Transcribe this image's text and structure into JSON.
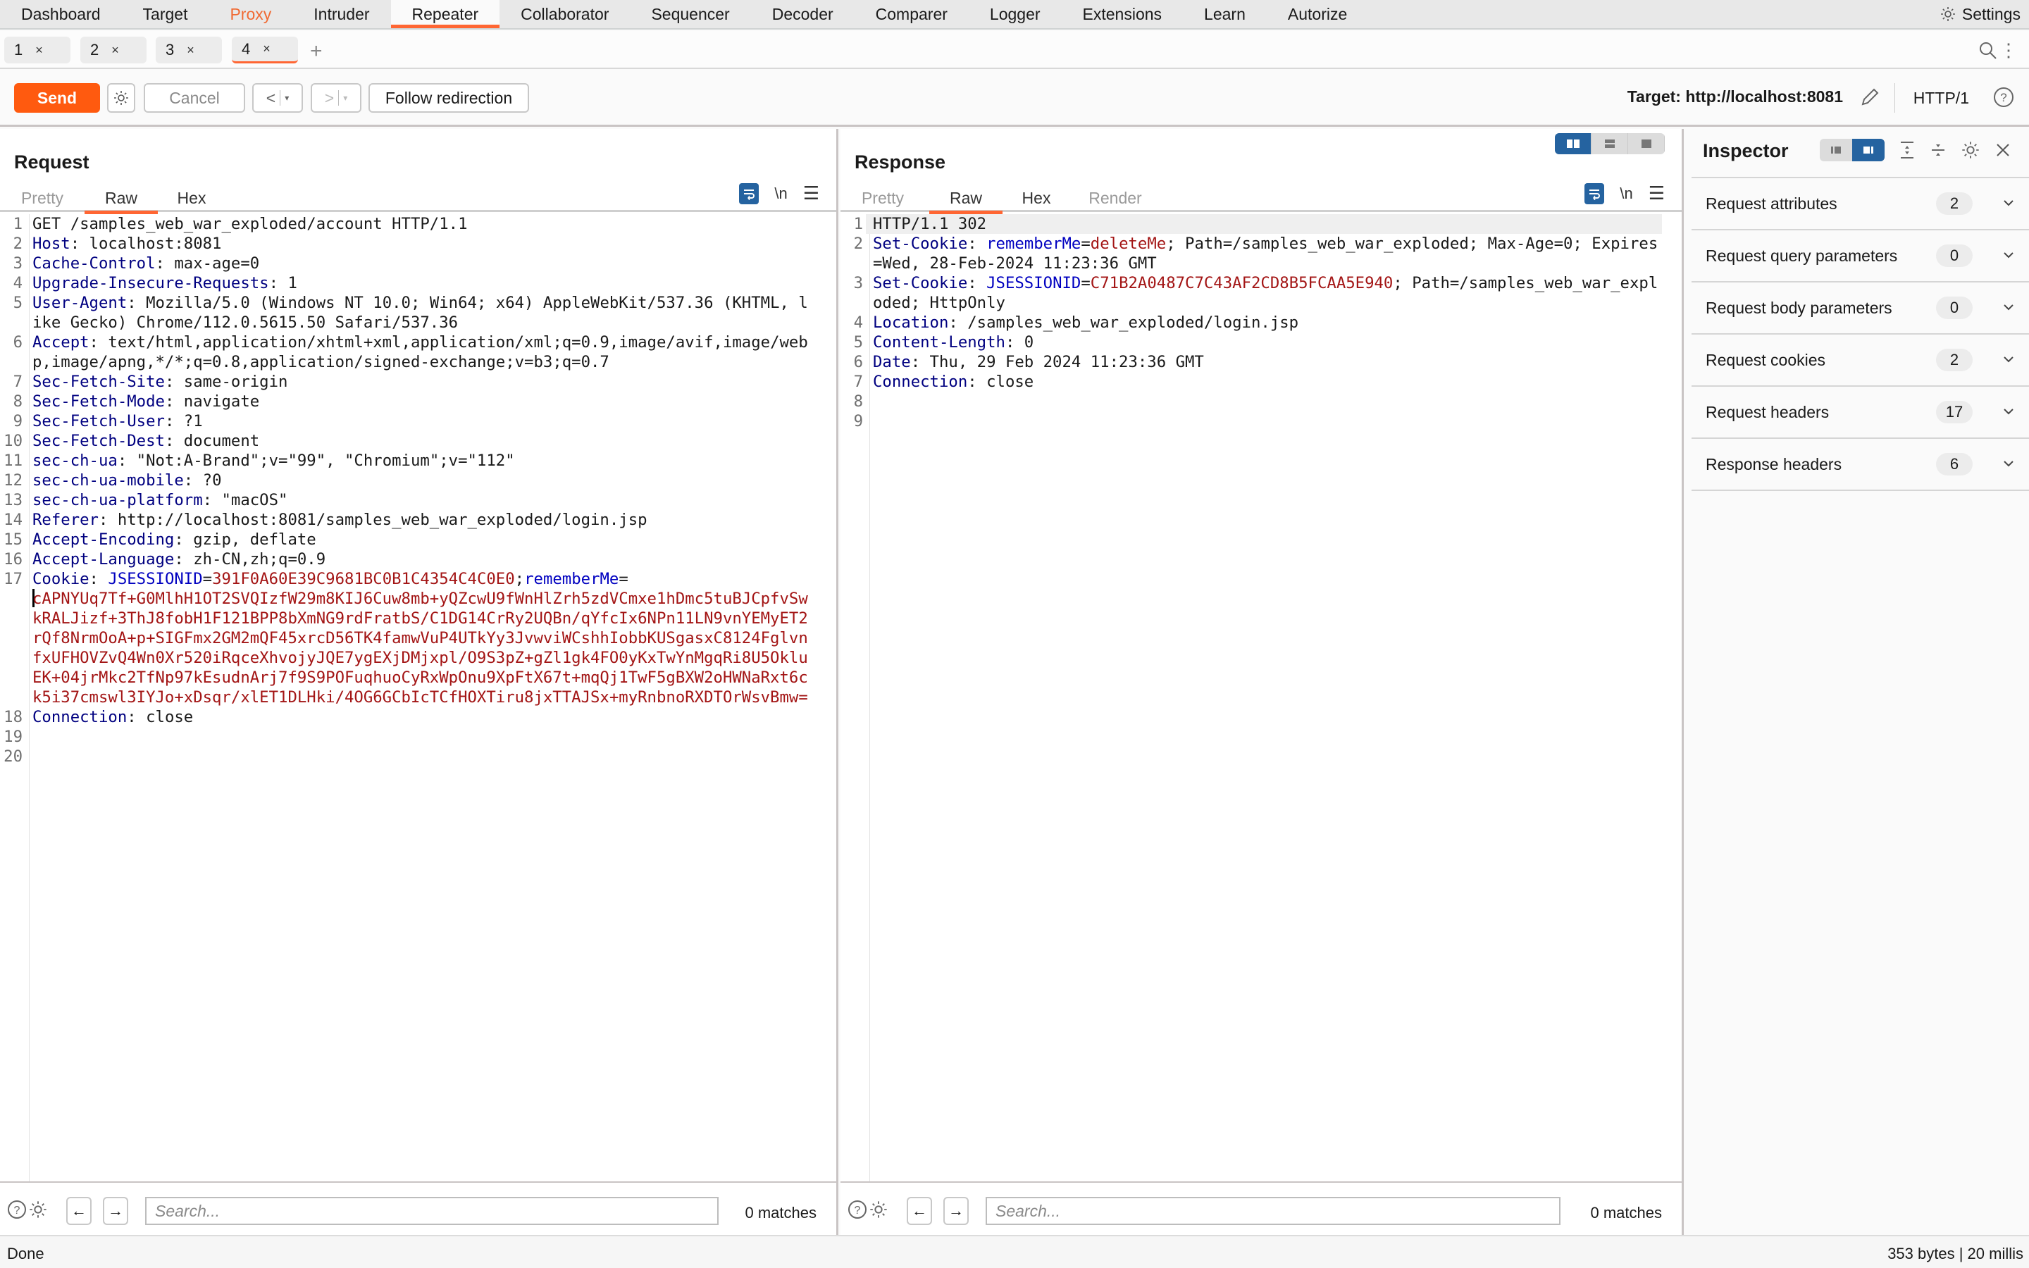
{
  "nav": {
    "items": [
      "Dashboard",
      "Target",
      "Proxy",
      "Intruder",
      "Repeater",
      "Collaborator",
      "Sequencer",
      "Decoder",
      "Comparer",
      "Logger",
      "Extensions",
      "Learn",
      "Autorize"
    ],
    "active": "Repeater",
    "highlighted": "Proxy",
    "settings_label": "Settings"
  },
  "repeater_tabs": {
    "tabs": [
      {
        "label": "1",
        "close": "×"
      },
      {
        "label": "2",
        "close": "×"
      },
      {
        "label": "3",
        "close": "×"
      },
      {
        "label": "4",
        "close": "×"
      }
    ],
    "active_index": 3,
    "add_label": "+"
  },
  "toolbar": {
    "send_label": "Send",
    "cancel_label": "Cancel",
    "back_label": "<",
    "forward_label": ">",
    "dropdown_glyph": "▾",
    "follow_label": "Follow redirection",
    "target_label": "Target: http://localhost:8081",
    "protocol_label": "HTTP/1"
  },
  "request": {
    "title": "Request",
    "tabs": [
      "Pretty",
      "Raw",
      "Hex"
    ],
    "active_tab": "Raw",
    "newline_label": "\\n",
    "lines": [
      {
        "n": "1",
        "parts": [
          {
            "t": "GET /samples_web_war_exploded/account HTTP/1.1",
            "c": "t"
          }
        ]
      },
      {
        "n": "2",
        "parts": [
          {
            "t": "Host",
            "c": "hn"
          },
          {
            "t": ": localhost:8081",
            "c": "t"
          }
        ]
      },
      {
        "n": "3",
        "parts": [
          {
            "t": "Cache-Control",
            "c": "hn"
          },
          {
            "t": ": max-age=0",
            "c": "t"
          }
        ]
      },
      {
        "n": "4",
        "parts": [
          {
            "t": "Upgrade-Insecure-Requests",
            "c": "hn"
          },
          {
            "t": ": 1",
            "c": "t"
          }
        ]
      },
      {
        "n": "5",
        "parts": [
          {
            "t": "User-Agent",
            "c": "hn"
          },
          {
            "t": ": Mozilla/5.0 (Windows NT 10.0; Win64; x64) AppleWebKit/537.36 (KHTML, like Gecko) Chrome/112.0.5615.50 Safari/537.36",
            "c": "t"
          }
        ]
      },
      {
        "n": "6",
        "parts": [
          {
            "t": "Accept",
            "c": "hn"
          },
          {
            "t": ": text/html,application/xhtml+xml,application/xml;q=0.9,image/avif,image/webp,image/apng,*/*;q=0.8,application/signed-exchange;v=b3;q=0.7",
            "c": "t"
          }
        ]
      },
      {
        "n": "7",
        "parts": [
          {
            "t": "Sec-Fetch-Site",
            "c": "hn"
          },
          {
            "t": ": same-origin",
            "c": "t"
          }
        ]
      },
      {
        "n": "8",
        "parts": [
          {
            "t": "Sec-Fetch-Mode",
            "c": "hn"
          },
          {
            "t": ": navigate",
            "c": "t"
          }
        ]
      },
      {
        "n": "9",
        "parts": [
          {
            "t": "Sec-Fetch-User",
            "c": "hn"
          },
          {
            "t": ": ?1",
            "c": "t"
          }
        ]
      },
      {
        "n": "10",
        "parts": [
          {
            "t": "Sec-Fetch-Dest",
            "c": "hn"
          },
          {
            "t": ": document",
            "c": "t"
          }
        ]
      },
      {
        "n": "11",
        "parts": [
          {
            "t": "sec-ch-ua",
            "c": "hn"
          },
          {
            "t": ": \"Not:A-Brand\";v=\"99\", \"Chromium\";v=\"112\"",
            "c": "t"
          }
        ]
      },
      {
        "n": "12",
        "parts": [
          {
            "t": "sec-ch-ua-mobile",
            "c": "hn"
          },
          {
            "t": ": ?0",
            "c": "t"
          }
        ]
      },
      {
        "n": "13",
        "parts": [
          {
            "t": "sec-ch-ua-platform",
            "c": "hn"
          },
          {
            "t": ": \"macOS\"",
            "c": "t"
          }
        ]
      },
      {
        "n": "14",
        "parts": [
          {
            "t": "Referer",
            "c": "hn"
          },
          {
            "t": ": http://localhost:8081/samples_web_war_exploded/login.jsp",
            "c": "t"
          }
        ]
      },
      {
        "n": "15",
        "parts": [
          {
            "t": "Accept-Encoding",
            "c": "hn"
          },
          {
            "t": ": gzip, deflate",
            "c": "t"
          }
        ]
      },
      {
        "n": "16",
        "parts": [
          {
            "t": "Accept-Language",
            "c": "hn"
          },
          {
            "t": ": zh-CN,zh;q=0.9",
            "c": "t"
          }
        ]
      },
      {
        "n": "17",
        "parts": [
          {
            "t": "Cookie",
            "c": "hn"
          },
          {
            "t": ": ",
            "c": "t"
          },
          {
            "t": "JSESSIONID",
            "c": "ck"
          },
          {
            "t": "=",
            "c": "t"
          },
          {
            "t": "391F0A60E39C9681BC0B1C4354C4C0E0",
            "c": "cv"
          },
          {
            "t": ";",
            "c": "t"
          },
          {
            "t": "rememberMe",
            "c": "ck"
          },
          {
            "t": "=",
            "c": "t"
          },
          {
            "t": "\n",
            "c": "t"
          },
          {
            "t": "cAPNYUq7Tf+G0MlhH1OT2SVQIzfW29m8KIJ6Cuw8mb+yQZcwU9fWnHlZrh5zdVCmxe1hDmc5tuBJCpfvSwkRALJizf+3ThJ8fobH1F121BPP8bXmNG9rdFratbS/C1DG14CrRy2UQBn/qYfcIx6NPn11LN9vnYEMyET2rQf8NrmOoA+p+SIGFmx2GM2mQF45xrcD56TK4famwVuP4UTkYy3JvwviWCshhIobbKUSgasxC8124FglvnfxUFHOVZvQ4Wn0Xr520iRqceXhvojyJQE7ygEXjDMjxpl/O9S3pZ+gZl1gk4FO0yKxTwYnMgqRi8U5OkluEK+04jrMkc2TfNp97kEsudnArj7f9S9POFuqhuoCyRxWpOnu9XpFtX67t+mqQj1TwF5gBXW2oHWNaRxt6ck5i37cmswl3IYJo+xDsqr/xlET1DLHki/4OG6GCbIcTCfHOXTiru8jxTTAJSx+myRnbnoRXDTOrWsvBmw=",
            "c": "cv"
          }
        ]
      },
      {
        "n": "18",
        "parts": [
          {
            "t": "Connection",
            "c": "hn"
          },
          {
            "t": ": close",
            "c": "t"
          }
        ]
      },
      {
        "n": "19",
        "parts": []
      },
      {
        "n": "20",
        "parts": []
      }
    ],
    "search_placeholder": "Search...",
    "search_value": "",
    "matches": "0 matches"
  },
  "response": {
    "title": "Response",
    "tabs": [
      "Pretty",
      "Raw",
      "Hex",
      "Render"
    ],
    "active_tab": "Raw",
    "newline_label": "\\n",
    "lines": [
      {
        "n": "1",
        "parts": [
          {
            "t": "HTTP/1.1 302",
            "c": "t"
          }
        ]
      },
      {
        "n": "2",
        "parts": [
          {
            "t": "Set-Cookie",
            "c": "hn"
          },
          {
            "t": ": ",
            "c": "t"
          },
          {
            "t": "rememberMe",
            "c": "ck"
          },
          {
            "t": "=",
            "c": "t"
          },
          {
            "t": "deleteMe",
            "c": "cv"
          },
          {
            "t": "; Path=/samples_web_war_exploded; Max-Age=0; Expires=Wed, 28-Feb-2024 11:23:36 GMT",
            "c": "t"
          }
        ]
      },
      {
        "n": "3",
        "parts": [
          {
            "t": "Set-Cookie",
            "c": "hn"
          },
          {
            "t": ": ",
            "c": "t"
          },
          {
            "t": "JSESSIONID",
            "c": "ck"
          },
          {
            "t": "=",
            "c": "t"
          },
          {
            "t": "C71B2A0487C7C43AF2CD8B5FCAA5E940",
            "c": "cv"
          },
          {
            "t": "; Path=/samples_web_war_exploded; HttpOnly",
            "c": "t"
          }
        ]
      },
      {
        "n": "4",
        "parts": [
          {
            "t": "Location",
            "c": "hn"
          },
          {
            "t": ": /samples_web_war_exploded/login.jsp",
            "c": "t"
          }
        ]
      },
      {
        "n": "5",
        "parts": [
          {
            "t": "Content-Length",
            "c": "hn"
          },
          {
            "t": ": 0",
            "c": "t"
          }
        ]
      },
      {
        "n": "6",
        "parts": [
          {
            "t": "Date",
            "c": "hn"
          },
          {
            "t": ": Thu, 29 Feb 2024 11:23:36 GMT",
            "c": "t"
          }
        ]
      },
      {
        "n": "7",
        "parts": [
          {
            "t": "Connection",
            "c": "hn"
          },
          {
            "t": ": close",
            "c": "t"
          }
        ]
      },
      {
        "n": "8",
        "parts": []
      },
      {
        "n": "9",
        "parts": []
      }
    ],
    "search_placeholder": "Search...",
    "search_value": "",
    "matches": "0 matches"
  },
  "inspector": {
    "title": "Inspector",
    "sections": [
      {
        "label": "Request attributes",
        "count": "2"
      },
      {
        "label": "Request query parameters",
        "count": "0"
      },
      {
        "label": "Request body parameters",
        "count": "0"
      },
      {
        "label": "Request cookies",
        "count": "2"
      },
      {
        "label": "Request headers",
        "count": "17"
      },
      {
        "label": "Response headers",
        "count": "6"
      }
    ]
  },
  "status": {
    "left": "Done",
    "right": "353 bytes | 20 millis"
  },
  "colors": {
    "accent": "#ff6633",
    "send": "#ff5a0f",
    "selected_blue": "#2563a0",
    "header_name": "#000080",
    "cookie_name": "#0000c0",
    "cookie_value": "#a31515"
  }
}
